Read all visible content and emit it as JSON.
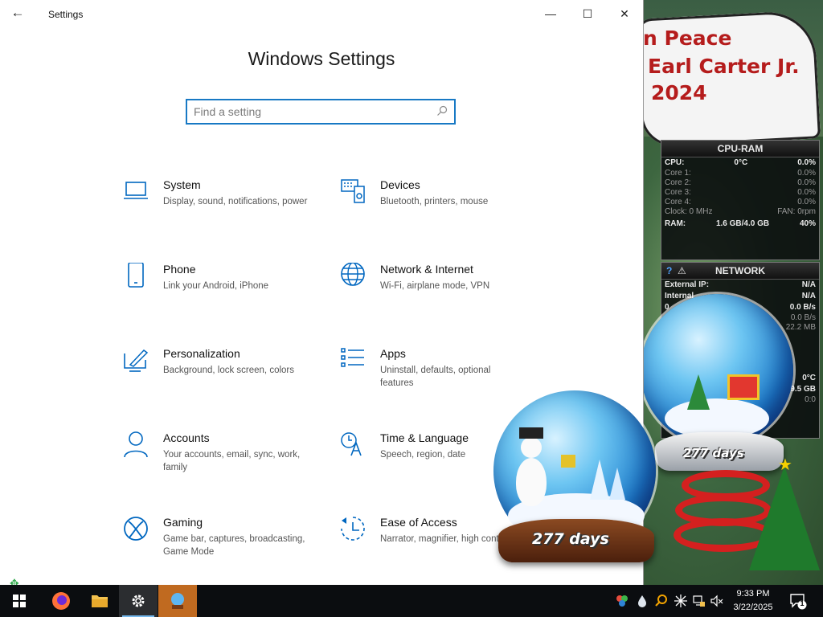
{
  "window": {
    "title": "Settings",
    "back_label": "←",
    "minimize_label": "—",
    "maximize_label": "☐",
    "close_label": "✕"
  },
  "page": {
    "title": "Windows Settings"
  },
  "search": {
    "placeholder": "Find a setting",
    "value": ""
  },
  "categories": [
    {
      "name": "System",
      "description": "Display, sound, notifications, power",
      "icon": "laptop-icon"
    },
    {
      "name": "Devices",
      "description": "Bluetooth, printers, mouse",
      "icon": "keyboard-speaker-icon"
    },
    {
      "name": "Phone",
      "description": "Link your Android, iPhone",
      "icon": "phone-icon"
    },
    {
      "name": "Network & Internet",
      "description": "Wi-Fi, airplane mode, VPN",
      "icon": "globe-icon"
    },
    {
      "name": "Personalization",
      "description": "Background, lock screen, colors",
      "icon": "paint-brush-icon"
    },
    {
      "name": "Apps",
      "description": "Uninstall, defaults, optional features",
      "icon": "apps-list-icon"
    },
    {
      "name": "Accounts",
      "description": "Your accounts, email, sync, work, family",
      "icon": "person-icon"
    },
    {
      "name": "Time & Language",
      "description": "Speech, region, date",
      "icon": "time-language-icon"
    },
    {
      "name": "Gaming",
      "description": "Game bar, captures, broadcasting, Game Mode",
      "icon": "xbox-icon"
    },
    {
      "name": "Ease of Access",
      "description": "Narrator, magnifier, high contrast",
      "icon": "ease-of-access-icon"
    }
  ],
  "desktop": {
    "poster_lines": [
      "n Peace",
      "Earl Carter Jr.",
      "2024"
    ],
    "globe_days": "277 days",
    "globe_days_small": "277 days"
  },
  "cpu_gadget": {
    "title": "CPU-RAM",
    "cpu_label": "CPU:",
    "cpu_temp": "0°C",
    "cpu_value": "0.0%",
    "cores": [
      {
        "label": "Core 1:",
        "value": "0.0%"
      },
      {
        "label": "Core 2:",
        "value": "0.0%"
      },
      {
        "label": "Core 3:",
        "value": "0.0%"
      },
      {
        "label": "Core 4:",
        "value": "0.0%"
      }
    ],
    "clock_label": "Clock: 0 MHz",
    "fan_label": "FAN: 0rpm",
    "ram_label": "RAM:",
    "ram_usage": "1.6 GB/4.0 GB",
    "ram_percent": "40%"
  },
  "net_gadget": {
    "title": "NETWORK",
    "help": "?",
    "warn": "⚠",
    "external_ip_label": "External IP:",
    "external_ip": "N/A",
    "internal_label": "Internal",
    "internal_value": "N/A",
    "row_a_label": "0",
    "row_a_value": "0.0 B/s",
    "row_b_value": "0.0 B/s",
    "row_c_value": "22.2 MB",
    "temp_value": "0°C",
    "size_value": "9.5 GB",
    "ratio_value": "0:0"
  },
  "taskbar": {
    "apps": [
      {
        "name": "start-button",
        "icon": "windows-logo-icon"
      },
      {
        "name": "firefox",
        "icon": "firefox-icon"
      },
      {
        "name": "file-explorer",
        "icon": "folder-icon"
      },
      {
        "name": "settings",
        "icon": "gear-icon"
      },
      {
        "name": "desktop-app",
        "icon": "snow-globe-app-icon"
      }
    ],
    "time": "9:33 PM",
    "date": "3/22/2025",
    "notification_count": "1"
  },
  "colors": {
    "accent": "#1879c4",
    "icon_blue": "#0067c0",
    "taskbar": "#0b0d10"
  }
}
